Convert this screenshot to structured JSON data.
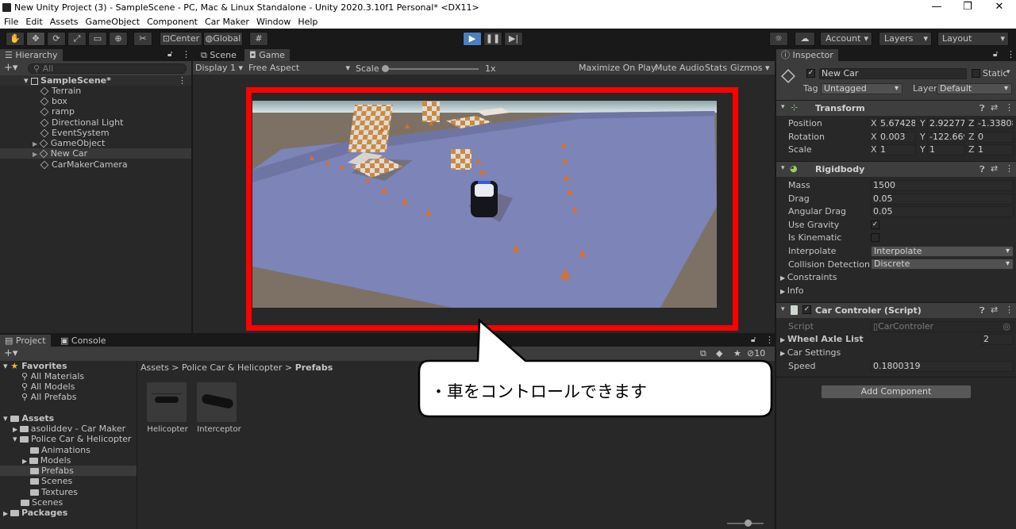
{
  "window": {
    "title": "New Unity Project (3) - SampleScene - PC, Mac & Linux Standalone - Unity 2020.3.10f1 Personal* <DX11>",
    "minimize": "—",
    "maximize": "❐",
    "close": "✕"
  },
  "menu": [
    "File",
    "Edit",
    "Assets",
    "GameObject",
    "Component",
    "Car Maker",
    "Window",
    "Help"
  ],
  "toolbar": {
    "center": "Center",
    "global": "Global",
    "account": "Account",
    "layers": "Layers",
    "layout": "Layout"
  },
  "hierarchy": {
    "tab": "Hierarchy",
    "search_placeholder": "All",
    "scene": "SampleScene*",
    "items": [
      "Terrain",
      "box",
      "ramp",
      "Directional Light",
      "EventSystem",
      "GameObject",
      "New Car",
      "CarMakerCamera"
    ]
  },
  "game": {
    "tab_scene": "Scene",
    "tab_game": "Game",
    "display": "Display 1",
    "aspect": "Free Aspect",
    "scale_label": "Scale",
    "scale_value": "1x",
    "maximize": "Maximize On Play",
    "mute": "Mute Audio",
    "stats": "Stats",
    "gizmos": "Gizmos"
  },
  "inspector": {
    "tab": "Inspector",
    "object_name": "New Car",
    "static": "Static",
    "tag_label": "Tag",
    "tag": "Untagged",
    "layer_label": "Layer",
    "layer": "Default",
    "transform": {
      "title": "Transform",
      "position_label": "Position",
      "rotation_label": "Rotation",
      "scale_label": "Scale",
      "position": [
        "5.674283",
        "2.922773",
        "-1.338083"
      ],
      "rotation": [
        "0.003",
        "-122.669",
        "0"
      ],
      "scale": [
        "1",
        "1",
        "1"
      ]
    },
    "rigidbody": {
      "title": "Rigidbody",
      "mass_label": "Mass",
      "mass": "1500",
      "drag_label": "Drag",
      "drag": "0.05",
      "angular_label": "Angular Drag",
      "angular": "0.05",
      "gravity_label": "Use Gravity",
      "kinematic_label": "Is Kinematic",
      "interpolate_label": "Interpolate",
      "interpolate": "Interpolate",
      "collision_label": "Collision Detection",
      "collision": "Discrete",
      "constraints": "Constraints",
      "info": "Info"
    },
    "script": {
      "title": "Car Controler (Script)",
      "script_label": "Script",
      "script_value": "CarControler",
      "wheel_label": "Wheel Axle List",
      "wheel_value": "2",
      "settings_label": "Car Settings",
      "speed_label": "Speed",
      "speed_value": "0.1800319"
    },
    "add_component": "Add Component"
  },
  "project": {
    "tab_project": "Project",
    "tab_console": "Console",
    "hidden_count": "10",
    "favorites": "Favorites",
    "fav_items": [
      "All Materials",
      "All Models",
      "All Prefabs"
    ],
    "assets": "Assets",
    "tree": [
      "asoliddev - Car Maker",
      "Police Car & Helicopter",
      "Animations",
      "Models",
      "Prefabs",
      "Scenes",
      "Textures",
      "Scenes"
    ],
    "packages": "Packages",
    "breadcrumb": [
      "Assets",
      "Police Car & Helicopter",
      "Prefabs"
    ],
    "prefabs": [
      "Helicopter",
      "Interceptor"
    ]
  },
  "callout": {
    "text": "・車をコントロールできます"
  },
  "colors": {
    "highlight": "#ff0000",
    "play": "#4c7fbf",
    "ground": "#7c84b8"
  }
}
